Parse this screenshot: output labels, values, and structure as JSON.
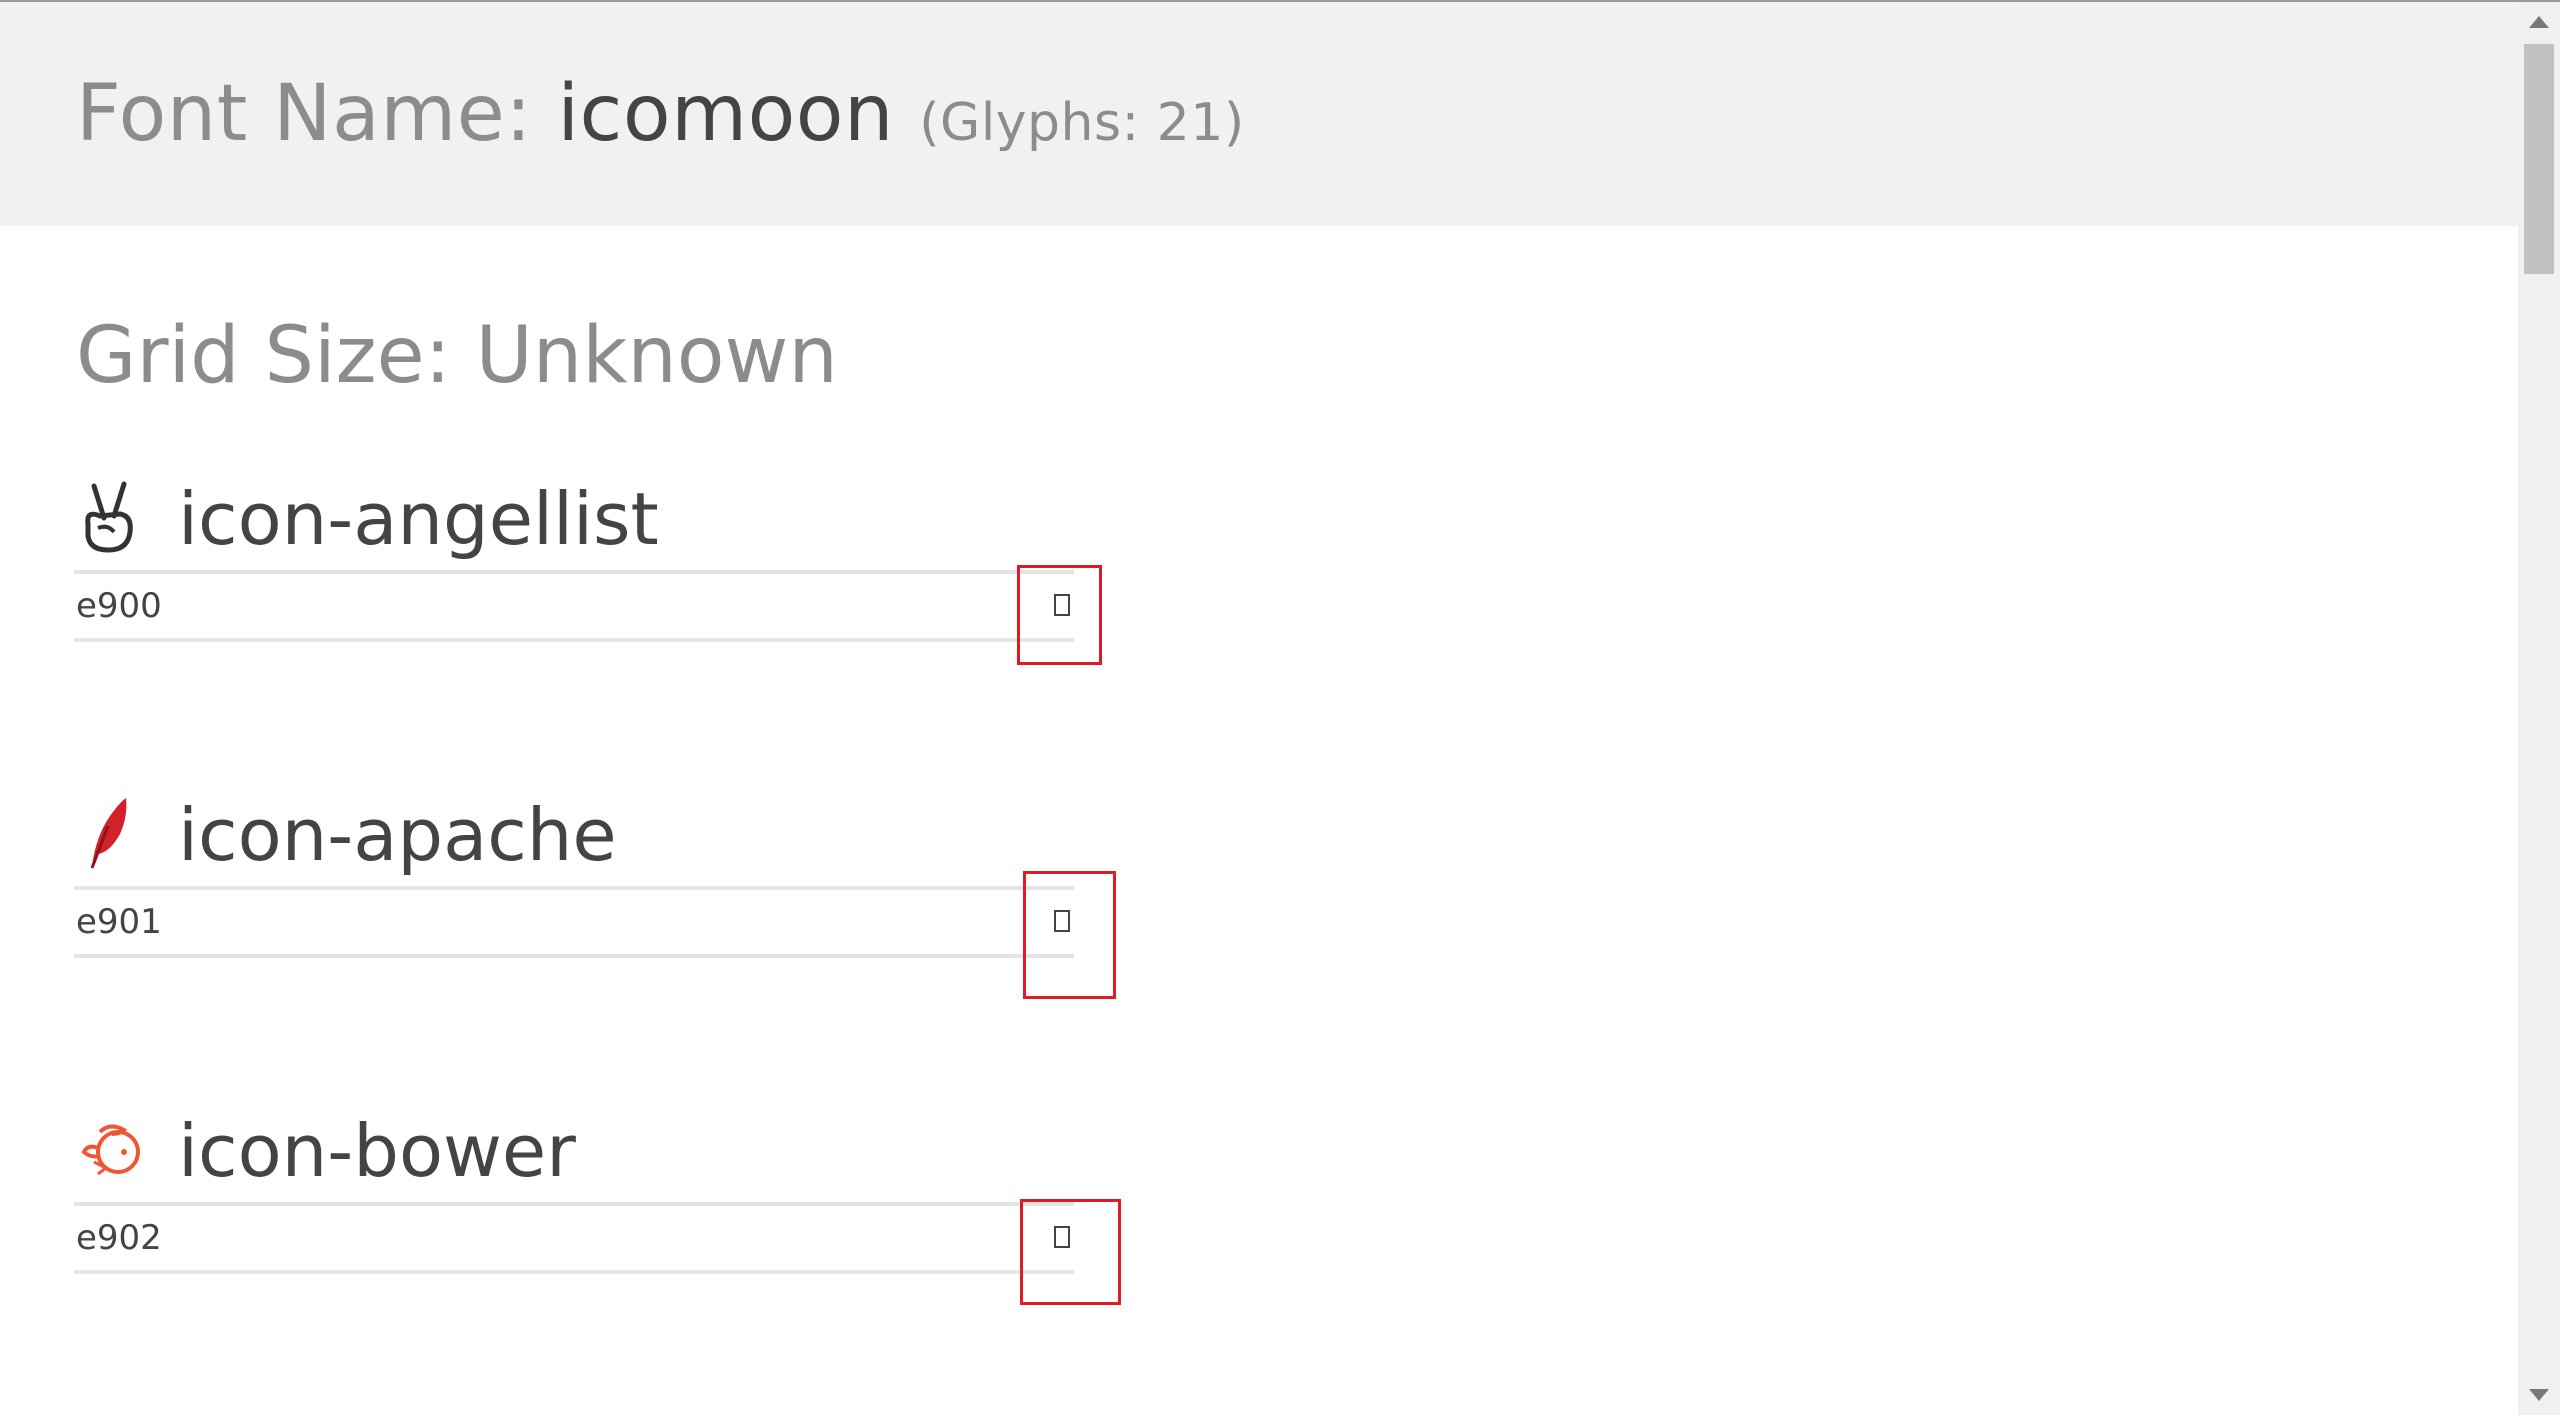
{
  "header": {
    "label": "Font Name:",
    "font_name": "icomoon",
    "glyph_count": "(Glyphs: 21)"
  },
  "grid": {
    "label": "Grid Size: Unknown"
  },
  "glyphs": [
    {
      "name": "icon-angellist",
      "code": "e900",
      "icon": "angellist-icon",
      "color": "#333333"
    },
    {
      "name": "icon-apache",
      "code": "e901",
      "icon": "apache-feather-icon",
      "color": "#d22128"
    },
    {
      "name": "icon-bower",
      "code": "e902",
      "icon": "bower-icon",
      "color": "#ef5734"
    }
  ],
  "colors": {
    "header_bg": "#f1f1f1",
    "muted_text": "#8c8c8c",
    "body_text": "#444444",
    "highlight": "#e01b24"
  }
}
